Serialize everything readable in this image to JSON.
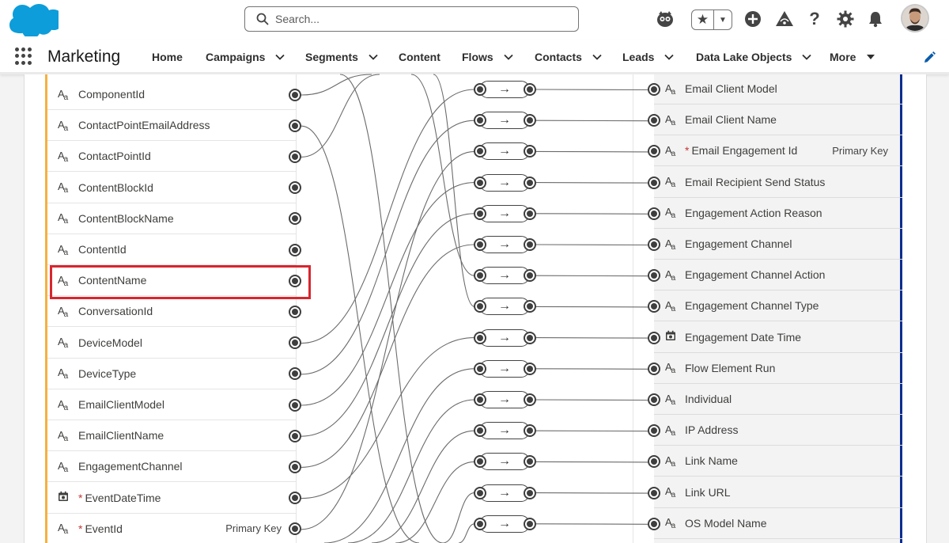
{
  "header": {
    "search_placeholder": "Search...",
    "icons": [
      "salesforce-logo",
      "einstein-icon",
      "favorites-star-icon",
      "add-icon",
      "trailhead-icon",
      "help-icon",
      "setup-gear-icon",
      "notifications-bell-icon",
      "user-avatar"
    ]
  },
  "nav": {
    "app_name": "Marketing",
    "items": [
      {
        "label": "Home",
        "dropdown": false
      },
      {
        "label": "Campaigns",
        "dropdown": true
      },
      {
        "label": "Segments",
        "dropdown": true
      },
      {
        "label": "Content",
        "dropdown": false
      },
      {
        "label": "Flows",
        "dropdown": true
      },
      {
        "label": "Contacts",
        "dropdown": true
      },
      {
        "label": "Leads",
        "dropdown": true
      },
      {
        "label": "Data Lake Objects",
        "dropdown": true
      },
      {
        "label": "More",
        "dropdown": true
      }
    ]
  },
  "source_fields": [
    {
      "name": "ComponentId",
      "type": "text",
      "required": false,
      "key": ""
    },
    {
      "name": "ContactPointEmailAddress",
      "type": "text",
      "required": false,
      "key": ""
    },
    {
      "name": "ContactPointId",
      "type": "text",
      "required": false,
      "key": ""
    },
    {
      "name": "ContentBlockId",
      "type": "text",
      "required": false,
      "key": ""
    },
    {
      "name": "ContentBlockName",
      "type": "text",
      "required": false,
      "key": ""
    },
    {
      "name": "ContentId",
      "type": "text",
      "required": false,
      "key": ""
    },
    {
      "name": "ContentName",
      "type": "text",
      "required": false,
      "key": "",
      "highlighted": true
    },
    {
      "name": "ConversationId",
      "type": "text",
      "required": false,
      "key": ""
    },
    {
      "name": "DeviceModel",
      "type": "text",
      "required": false,
      "key": ""
    },
    {
      "name": "DeviceType",
      "type": "text",
      "required": false,
      "key": ""
    },
    {
      "name": "EmailClientModel",
      "type": "text",
      "required": false,
      "key": ""
    },
    {
      "name": "EmailClientName",
      "type": "text",
      "required": false,
      "key": ""
    },
    {
      "name": "EngagementChannel",
      "type": "text",
      "required": false,
      "key": ""
    },
    {
      "name": "EventDateTime",
      "type": "datetime",
      "required": true,
      "key": ""
    },
    {
      "name": "EventId",
      "type": "text",
      "required": true,
      "key": "Primary Key"
    }
  ],
  "target_fields": [
    {
      "name": "Email Client Model",
      "type": "text",
      "required": false,
      "key": ""
    },
    {
      "name": "Email Client Name",
      "type": "text",
      "required": false,
      "key": ""
    },
    {
      "name": "Email Engagement Id",
      "type": "text",
      "required": true,
      "key": "Primary Key"
    },
    {
      "name": "Email Recipient Send Status",
      "type": "text",
      "required": false,
      "key": ""
    },
    {
      "name": "Engagement Action Reason",
      "type": "text",
      "required": false,
      "key": ""
    },
    {
      "name": "Engagement Channel",
      "type": "text",
      "required": false,
      "key": ""
    },
    {
      "name": "Engagement Channel Action",
      "type": "text",
      "required": false,
      "key": ""
    },
    {
      "name": "Engagement Channel Type",
      "type": "text",
      "required": false,
      "key": ""
    },
    {
      "name": "Engagement Date Time",
      "type": "datetime",
      "required": false,
      "key": ""
    },
    {
      "name": "Flow Element Run",
      "type": "text",
      "required": false,
      "key": ""
    },
    {
      "name": "Individual",
      "type": "text",
      "required": false,
      "key": ""
    },
    {
      "name": "IP Address",
      "type": "text",
      "required": false,
      "key": ""
    },
    {
      "name": "Link Name",
      "type": "text",
      "required": false,
      "key": ""
    },
    {
      "name": "Link URL",
      "type": "text",
      "required": false,
      "key": ""
    },
    {
      "name": "OS Model Name",
      "type": "text",
      "required": false,
      "key": ""
    }
  ],
  "transform_symbol": "→",
  "colors": {
    "brand_blue": "#0d9dda",
    "source_accent": "#f6b13f",
    "target_accent": "#0b2d8f",
    "highlight": "#d8262e"
  }
}
